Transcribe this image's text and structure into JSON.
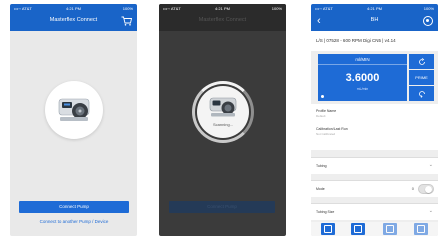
{
  "colors": {
    "brand_blue": "#1e6bd6",
    "navbar_blue": "#1964c8",
    "dark_overlay": "#3b3b3b",
    "light_bg": "#e9e9e9"
  },
  "phone1": {
    "status": {
      "carrier": "•••◦◦ AT&T",
      "time": "4:21 PM",
      "battery": "100%"
    },
    "nav_title": "Masterflex Connect",
    "cart_icon": "cart-icon",
    "connect_button": "Connect Pump",
    "secondary_link": "Connect to another Pump / Device"
  },
  "phone2": {
    "status": {
      "carrier": "•••◦◦ AT&T",
      "time": "4:21 PM",
      "battery": "100%"
    },
    "nav_title": "Masterflex Connect",
    "scanning_text": "Scanning...",
    "button_label": "Connect Pump"
  },
  "phone3": {
    "status": {
      "carrier": "•••◦◦ AT&T",
      "time": "4:21 PM",
      "battery": "100%"
    },
    "nav_title": "BH",
    "device_name": "L/S | 07528 - 600 RPM Digi CN5 | v4.14",
    "mode_label": "ml/MIN",
    "flow_value": "3.6000",
    "flow_unit": "mL/min",
    "side_buttons": [
      "",
      "",
      "PRIME"
    ],
    "info": {
      "profile_label": "Profile Name",
      "profile_value": "Default",
      "calibration_label": "Calibration/Last Run",
      "calibration_value": "Not Calibrated"
    },
    "rows": {
      "tubing_label": "Tubing",
      "mode_label": "Mode",
      "mode_value": "0",
      "tubing_size_label": "Tubing Size"
    }
  }
}
